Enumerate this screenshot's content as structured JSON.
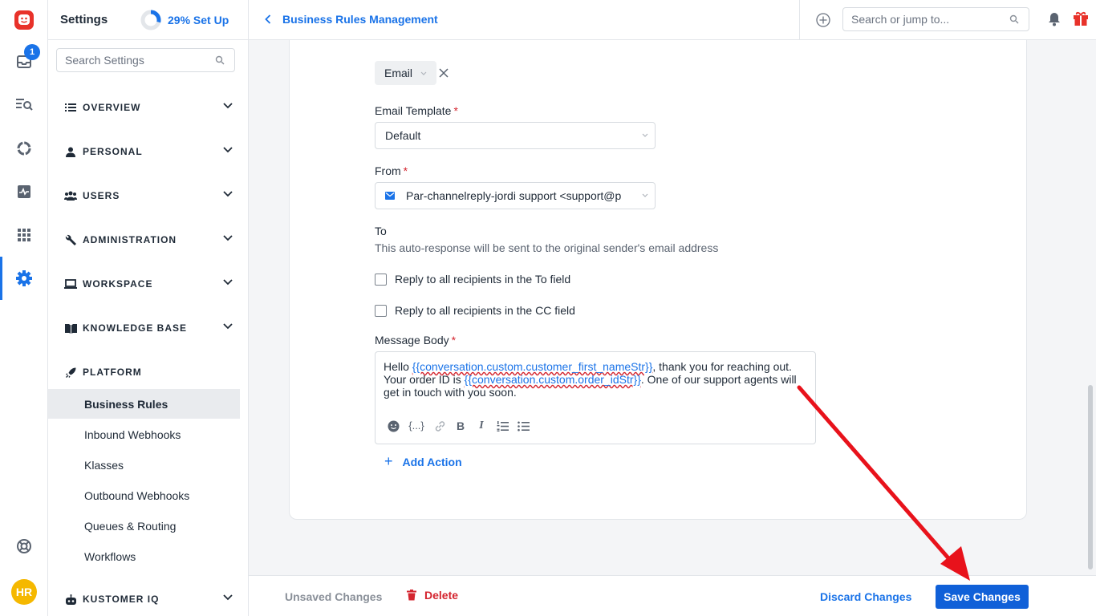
{
  "rail": {
    "notification_count": "1",
    "avatar_initials": "HR"
  },
  "sidebar": {
    "title": "Settings",
    "setup_progress": 29,
    "setup_label": "29% Set Up",
    "search_placeholder": "Search Settings",
    "sections": [
      {
        "label": "OVERVIEW",
        "icon": "list-icon"
      },
      {
        "label": "PERSONAL",
        "icon": "person-icon"
      },
      {
        "label": "USERS",
        "icon": "users-icon"
      },
      {
        "label": "ADMINISTRATION",
        "icon": "wrench-icon"
      },
      {
        "label": "WORKSPACE",
        "icon": "laptop-icon"
      },
      {
        "label": "KNOWLEDGE BASE",
        "icon": "book-icon"
      },
      {
        "label": "PLATFORM",
        "icon": "rocket-icon"
      },
      {
        "label": "KUSTOMER IQ",
        "icon": "robot-icon"
      }
    ],
    "platform_items": [
      "Business Rules",
      "Inbound Webhooks",
      "Klasses",
      "Outbound Webhooks",
      "Queues & Routing",
      "Workflows"
    ]
  },
  "header": {
    "breadcrumb": "Business Rules Management",
    "search_placeholder": "Search or jump to..."
  },
  "form": {
    "channel_chip": "Email",
    "email_template_label": "Email Template",
    "email_template_value": "Default",
    "from_label": "From",
    "from_value": "Par-channelreply-jordi support <support@p",
    "to_label": "To",
    "to_note": "This auto-response will be sent to the original sender's email address",
    "reply_to_label": "Reply to all recipients in the To field",
    "reply_cc_label": "Reply to all recipients in the CC field",
    "message_body_label": "Message Body",
    "required_mark": "*",
    "body": {
      "t1": "Hello ",
      "v1": "{{conversation.custom.customer_first_nameStr}}",
      "t2": ", thank you for reaching out. Your order ID is ",
      "v2": "{{conversation.custom.order_idStr}}",
      "t3": ". One of our support agents will get in touch with you soon."
    },
    "add_action": "Add Action"
  },
  "footer": {
    "unsaved": "Unsaved Changes",
    "delete": "Delete",
    "discard": "Discard Changes",
    "save": "Save Changes"
  },
  "colors": {
    "accent": "#1a73e8",
    "danger": "#d4252f",
    "save_button": "#1060d8",
    "arrow": "#e8121b"
  }
}
